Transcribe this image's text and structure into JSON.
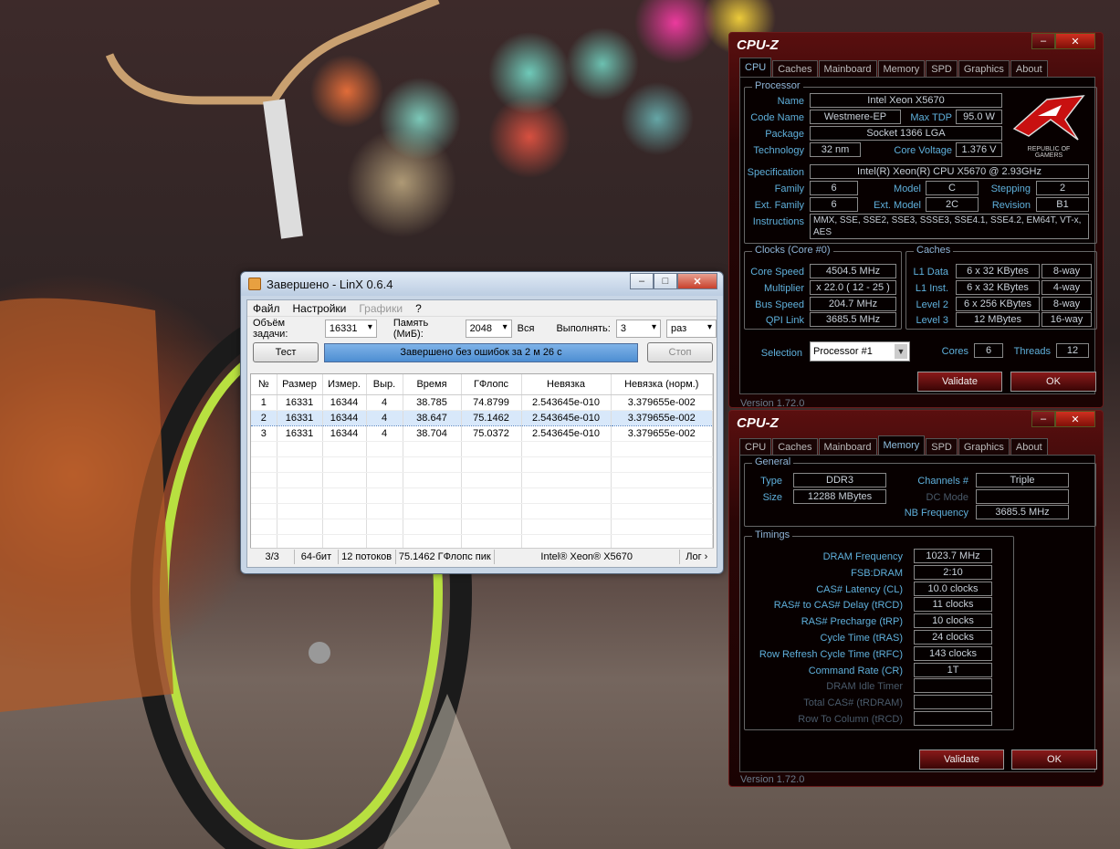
{
  "linx": {
    "title": "Завершено - LinX 0.6.4",
    "menu": [
      "Файл",
      "Настройки",
      "Графики",
      "?"
    ],
    "task_label": "Объём задачи:",
    "task_value": "16331",
    "memory_label": "Память (МиБ):",
    "memory_value": "2048",
    "all_label": "Вся",
    "run_label": "Выполнять:",
    "run_value": "3",
    "run_unit": "раз",
    "test_button": "Тест",
    "progress_text": "Завершено без ошибок за 2 м 26 с",
    "progress": 1.0,
    "stop_button": "Стоп",
    "columns": [
      "№",
      "Размер",
      "Измер.",
      "Выр.",
      "Время",
      "ГФлопс",
      "Невязка",
      "Невязка (норм.)"
    ],
    "rows": [
      [
        "1",
        "16331",
        "16344",
        "4",
        "38.785",
        "74.8799",
        "2.543645e-010",
        "3.379655e-002"
      ],
      [
        "2",
        "16331",
        "16344",
        "4",
        "38.647",
        "75.1462",
        "2.543645e-010",
        "3.379655e-002"
      ],
      [
        "3",
        "16331",
        "16344",
        "4",
        "38.704",
        "75.0372",
        "2.543645e-010",
        "3.379655e-002"
      ]
    ],
    "status": {
      "count": "3/3",
      "bits": "64-бит",
      "threads": "12 потоков",
      "peak": "75.1462 ГФлопс пик",
      "cpu": "Intel® Xeon® X5670",
      "log": "Лог ›"
    }
  },
  "cpuz_cpu": {
    "title": "CPU-Z",
    "tabs": [
      "CPU",
      "Caches",
      "Mainboard",
      "Memory",
      "SPD",
      "Graphics",
      "About"
    ],
    "active_tab": "CPU",
    "processor_group": "Processor",
    "name_label": "Name",
    "name": "Intel Xeon X5670",
    "codename_label": "Code Name",
    "codename": "Westmere-EP",
    "maxtdp_label": "Max TDP",
    "maxtdp": "95.0 W",
    "package_label": "Package",
    "package": "Socket 1366 LGA",
    "tech_label": "Technology",
    "tech": "32 nm",
    "voltage_label": "Core Voltage",
    "voltage": "1.376 V",
    "spec_label": "Specification",
    "spec": "Intel(R) Xeon(R) CPU           X5670  @ 2.93GHz",
    "family_label": "Family",
    "family": "6",
    "model_label": "Model",
    "model": "C",
    "stepping_label": "Stepping",
    "stepping": "2",
    "extfamily_label": "Ext. Family",
    "extfamily": "6",
    "extmodel_label": "Ext. Model",
    "extmodel": "2C",
    "revision_label": "Revision",
    "revision": "B1",
    "instructions_label": "Instructions",
    "instructions": "MMX, SSE, SSE2, SSE3, SSSE3, SSE4.1, SSE4.2, EM64T, VT-x, AES",
    "logo_text": "REPUBLIC OF GAMERS",
    "clocks_group": "Clocks (Core #0)",
    "corespeed_label": "Core Speed",
    "corespeed": "4504.5 MHz",
    "multiplier_label": "Multiplier",
    "multiplier": "x 22.0 ( 12 - 25 )",
    "busspeed_label": "Bus Speed",
    "busspeed": "204.7 MHz",
    "qpi_label": "QPI Link",
    "qpi": "3685.5 MHz",
    "caches_group": "Caches",
    "l1d_label": "L1 Data",
    "l1d": "6 x 32 KBytes",
    "l1d_way": "8-way",
    "l1i_label": "L1 Inst.",
    "l1i": "6 x 32 KBytes",
    "l1i_way": "4-way",
    "l2_label": "Level 2",
    "l2": "6 x 256 KBytes",
    "l2_way": "8-way",
    "l3_label": "Level 3",
    "l3": "12 MBytes",
    "l3_way": "16-way",
    "selection_label": "Selection",
    "selection": "Processor #1",
    "cores_label": "Cores",
    "cores": "6",
    "threads_label": "Threads",
    "threads": "12",
    "validate": "Validate",
    "ok": "OK",
    "version": "Version 1.72.0"
  },
  "cpuz_mem": {
    "title": "CPU-Z",
    "tabs": [
      "CPU",
      "Caches",
      "Mainboard",
      "Memory",
      "SPD",
      "Graphics",
      "About"
    ],
    "active_tab": "Memory",
    "general_group": "General",
    "type_label": "Type",
    "type": "DDR3",
    "size_label": "Size",
    "size": "12288 MBytes",
    "channels_label": "Channels #",
    "channels": "Triple",
    "dcmode_label": "DC Mode",
    "dcmode": "",
    "nbfreq_label": "NB Frequency",
    "nbfreq": "3685.5 MHz",
    "timings_group": "Timings",
    "timings": [
      {
        "label": "DRAM Frequency",
        "value": "1023.7 MHz",
        "dim": false
      },
      {
        "label": "FSB:DRAM",
        "value": "2:10",
        "dim": false
      },
      {
        "label": "CAS# Latency (CL)",
        "value": "10.0 clocks",
        "dim": false
      },
      {
        "label": "RAS# to CAS# Delay (tRCD)",
        "value": "11 clocks",
        "dim": false
      },
      {
        "label": "RAS# Precharge (tRP)",
        "value": "10 clocks",
        "dim": false
      },
      {
        "label": "Cycle Time (tRAS)",
        "value": "24 clocks",
        "dim": false
      },
      {
        "label": "Row Refresh Cycle Time (tRFC)",
        "value": "143 clocks",
        "dim": false
      },
      {
        "label": "Command Rate (CR)",
        "value": "1T",
        "dim": false
      },
      {
        "label": "DRAM Idle Timer",
        "value": "",
        "dim": true
      },
      {
        "label": "Total CAS# (tRDRAM)",
        "value": "",
        "dim": true
      },
      {
        "label": "Row To Column (tRCD)",
        "value": "",
        "dim": true
      }
    ],
    "validate": "Validate",
    "ok": "OK",
    "version": "Version 1.72.0"
  }
}
